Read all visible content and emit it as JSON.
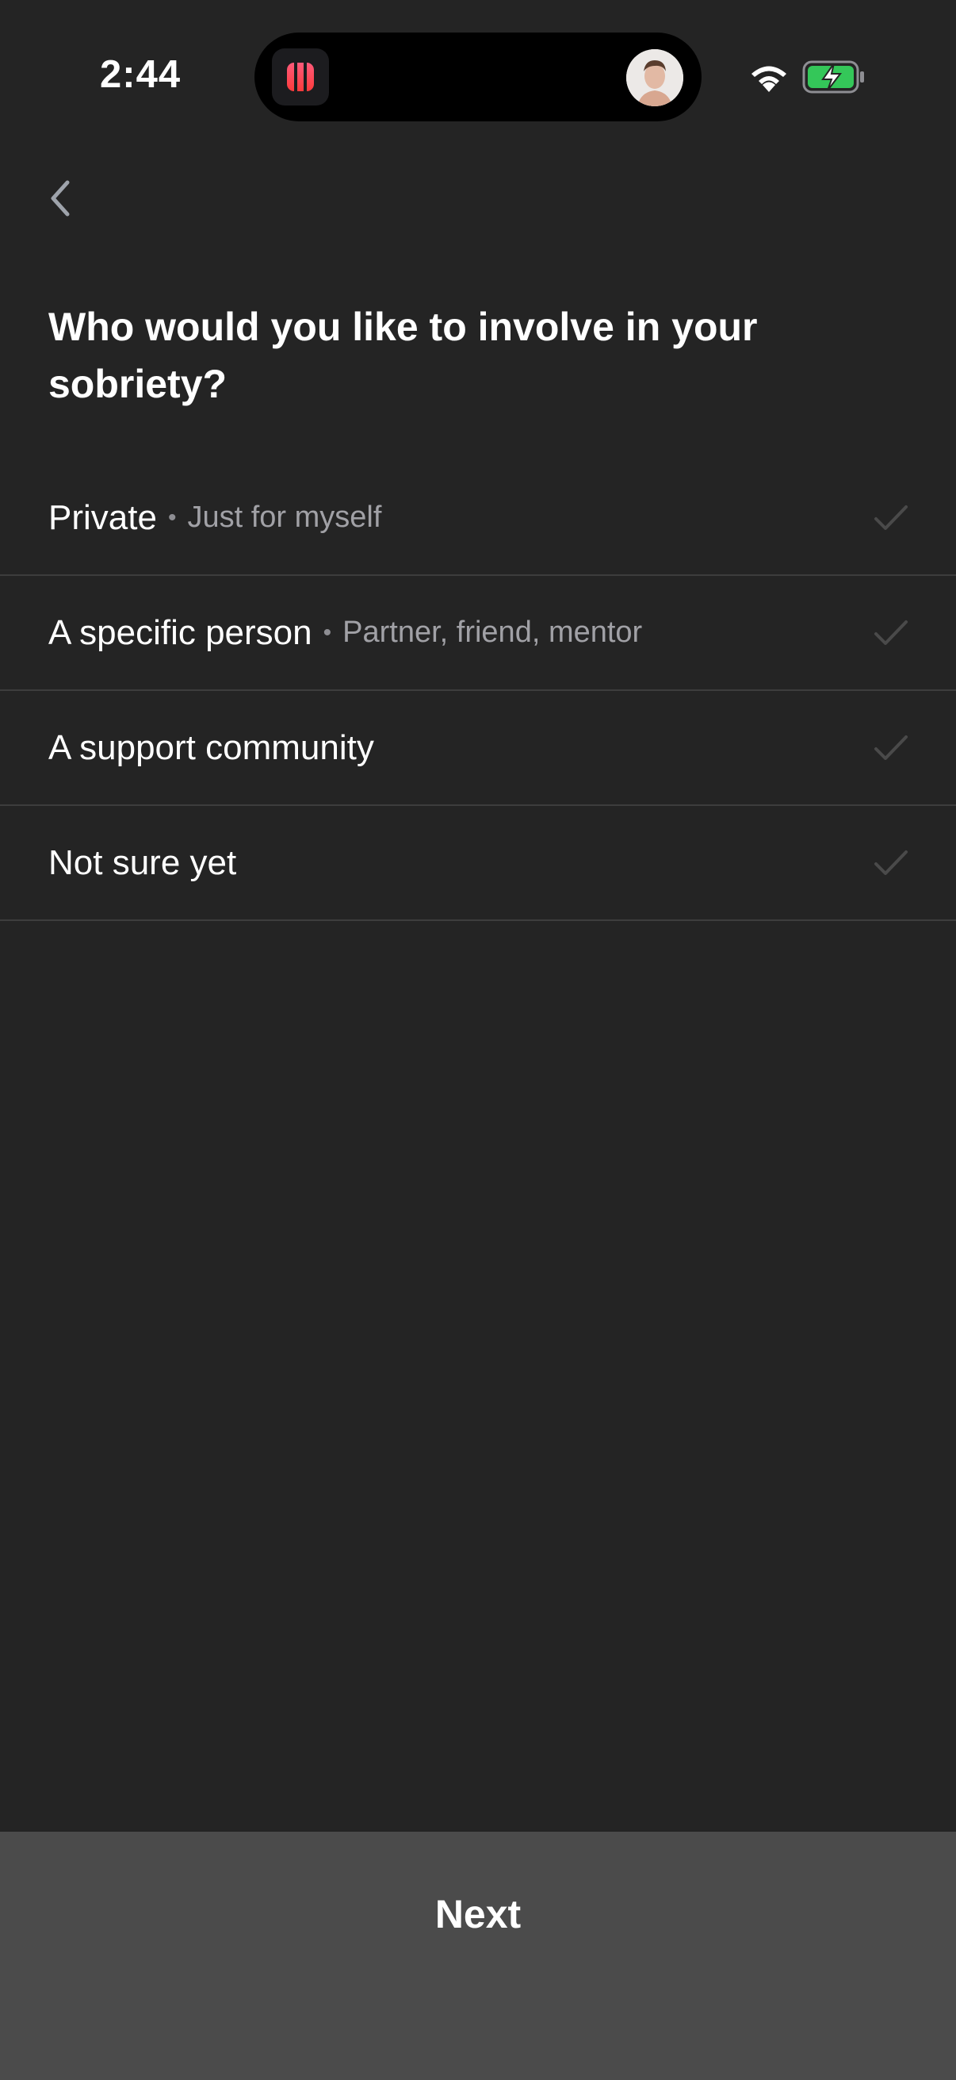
{
  "status_bar": {
    "time": "2:44"
  },
  "title": "Who would you like to involve in your sobriety?",
  "options": [
    {
      "label": "Private",
      "separator": "•",
      "sublabel": "Just for myself"
    },
    {
      "label": "A specific person",
      "separator": "•",
      "sublabel": "Partner, friend, mentor"
    },
    {
      "label": "A support community",
      "separator": "",
      "sublabel": ""
    },
    {
      "label": "Not sure yet",
      "separator": "",
      "sublabel": ""
    }
  ],
  "next_label": "Next",
  "icons": {
    "back": "chevron-left-icon",
    "check": "checkmark-icon",
    "wifi": "wifi-icon",
    "battery": "battery-charging-icon"
  },
  "colors": {
    "background": "#242424",
    "divider": "#3d3d3d",
    "check_unselected": "#4a4a4a",
    "button_background": "#4b4b4b",
    "battery_fill": "#34c759",
    "app_icon_accent": "#ff3b5c"
  }
}
